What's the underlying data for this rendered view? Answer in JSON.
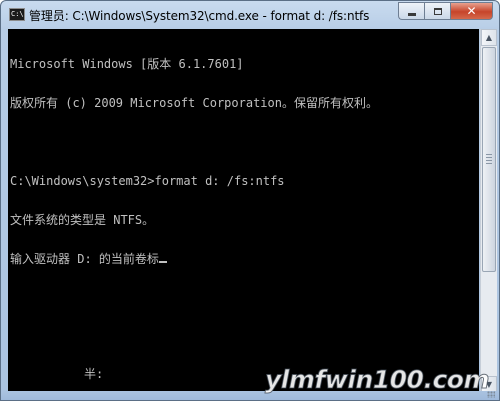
{
  "window": {
    "title": "管理员: C:\\Windows\\System32\\cmd.exe - format  d: /fs:ntfs",
    "app_icon_text": "C:\\",
    "buttons": {
      "minimize": "minimize",
      "maximize": "maximize",
      "close": "✕"
    }
  },
  "console": {
    "lines": [
      "Microsoft Windows [版本 6.1.7601]",
      "版权所有 (c) 2009 Microsoft Corporation。保留所有权利。",
      "",
      "C:\\Windows\\system32>format d: /fs:ntfs",
      "文件系统的类型是 NTFS。",
      "输入驱动器 D: 的当前卷标"
    ],
    "ime_status": "半:",
    "colors": {
      "background": "#000000",
      "text": "#c0c0c0"
    }
  },
  "scrollbar": {
    "up_arrow": "▲",
    "down_arrow": "▼"
  },
  "watermark": "ylmfwin100.com"
}
